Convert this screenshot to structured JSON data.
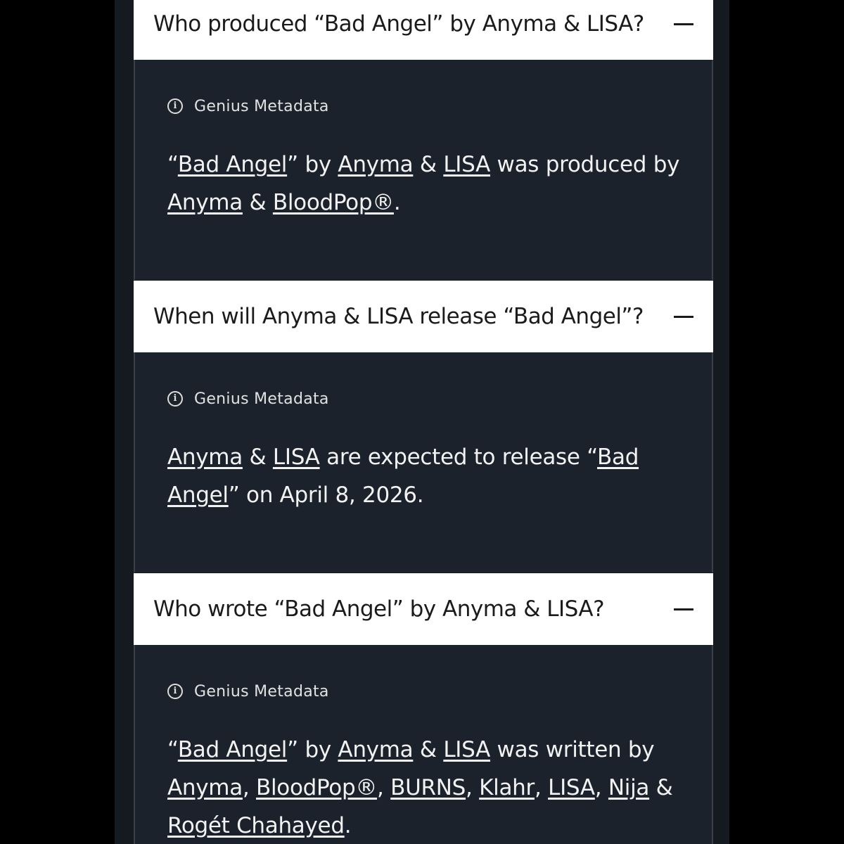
{
  "faqs": [
    {
      "question": "Who produced “Bad Angel” by Anyma & LISA?",
      "meta_label": "Genius Metadata",
      "answer": [
        {
          "t": "“"
        },
        {
          "t": "Bad Angel",
          "link": true
        },
        {
          "t": "” by "
        },
        {
          "t": "Anyma",
          "link": true
        },
        {
          "t": " & "
        },
        {
          "t": "LISA",
          "link": true
        },
        {
          "t": " was produced by "
        },
        {
          "t": "Anyma",
          "link": true
        },
        {
          "t": " & "
        },
        {
          "t": "BloodPop®",
          "link": true
        },
        {
          "t": "."
        }
      ]
    },
    {
      "question": "When will Anyma & LISA release “Bad Angel”?",
      "meta_label": "Genius Metadata",
      "answer": [
        {
          "t": "Anyma",
          "link": true
        },
        {
          "t": " & "
        },
        {
          "t": "LISA",
          "link": true
        },
        {
          "t": " are expected to release “"
        },
        {
          "t": "Bad Angel",
          "link": true
        },
        {
          "t": "” on April 8, 2026."
        }
      ]
    },
    {
      "question": "Who wrote “Bad Angel” by Anyma & LISA?",
      "meta_label": "Genius Metadata",
      "answer": [
        {
          "t": "“"
        },
        {
          "t": "Bad Angel",
          "link": true
        },
        {
          "t": "” by "
        },
        {
          "t": "Anyma",
          "link": true
        },
        {
          "t": " & "
        },
        {
          "t": "LISA",
          "link": true
        },
        {
          "t": " was written by "
        },
        {
          "t": "Anyma",
          "link": true
        },
        {
          "t": ", "
        },
        {
          "t": "BloodPop®",
          "link": true
        },
        {
          "t": ", "
        },
        {
          "t": "BURNS",
          "link": true
        },
        {
          "t": ", "
        },
        {
          "t": "Klahr",
          "link": true
        },
        {
          "t": ", "
        },
        {
          "t": "LISA",
          "link": true
        },
        {
          "t": ", "
        },
        {
          "t": "Nija",
          "link": true
        },
        {
          "t": " & "
        },
        {
          "t": "Rogét Chahayed",
          "link": true
        },
        {
          "t": "."
        }
      ]
    }
  ],
  "icons": {
    "info": "info-icon",
    "collapse": "minus-icon"
  }
}
